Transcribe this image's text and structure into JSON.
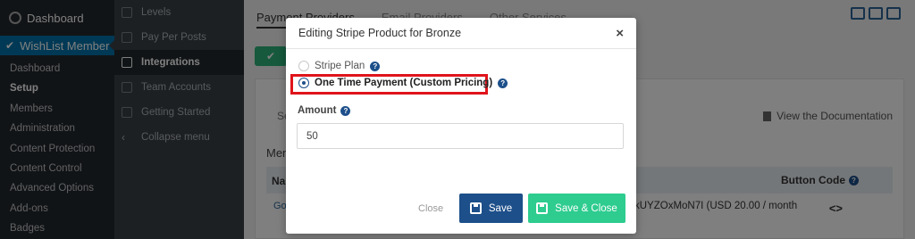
{
  "wp_sidebar": {
    "dashboard_label": "Dashboard",
    "plugin_label": "WishList Member",
    "items": [
      {
        "label": "Dashboard"
      },
      {
        "label": "Setup"
      },
      {
        "label": "Members"
      },
      {
        "label": "Administration"
      },
      {
        "label": "Content Protection"
      },
      {
        "label": "Content Control"
      },
      {
        "label": "Advanced Options"
      },
      {
        "label": "Add-ons"
      },
      {
        "label": "Badges"
      }
    ]
  },
  "sub_sidebar": {
    "items": [
      {
        "label": "Levels"
      },
      {
        "label": "Pay Per Posts"
      },
      {
        "label": "Integrations"
      },
      {
        "label": "Team Accounts"
      },
      {
        "label": "Getting Started"
      },
      {
        "label": "Collapse menu"
      }
    ]
  },
  "page": {
    "tab_active": "Payment Providers",
    "tab_2": "Email Providers",
    "tab_3": "Other Services",
    "sub_tab": "Se",
    "doc_link": "View the Documentation",
    "members_title": "Mem",
    "col_name": "Na",
    "col_button_code": "Button Code",
    "row_name": "Gol",
    "row_price": "kUYZOxMoN7I (USD 20.00 / month",
    "row_code": "<>"
  },
  "modal": {
    "title": "Editing Stripe Product for Bronze",
    "close_symbol": "×",
    "option_plan": "Stripe Plan",
    "option_one_time": "One Time Payment (Custom Pricing)",
    "amount_label": "Amount",
    "amount_value": "50",
    "btn_close": "Close",
    "btn_save": "Save",
    "btn_save_close": "Save & Close",
    "help_symbol": "?"
  }
}
